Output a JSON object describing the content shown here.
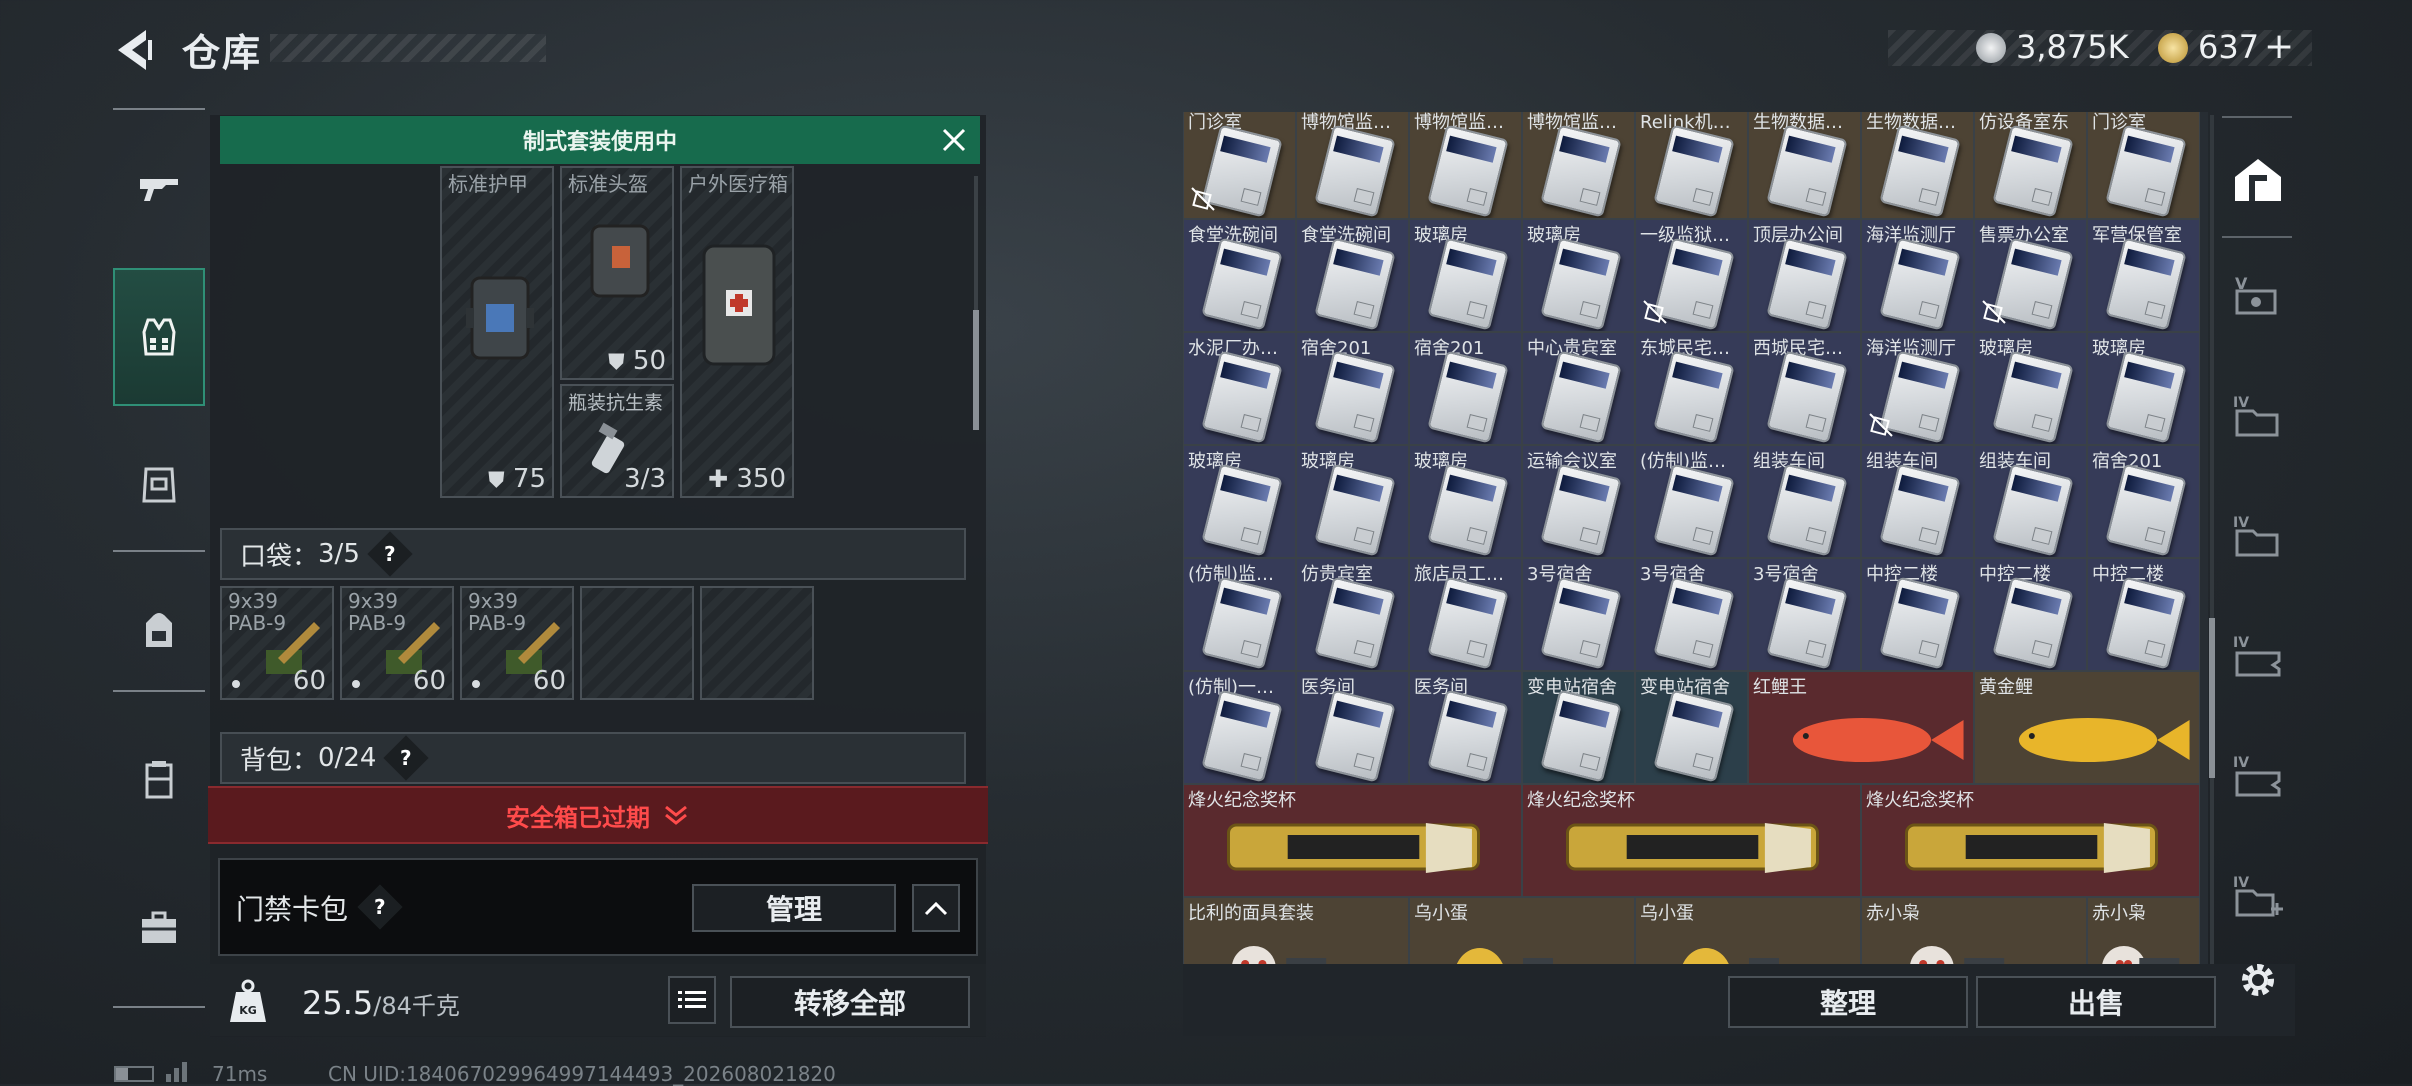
{
  "header": {
    "title": "仓库"
  },
  "currency": {
    "silver": "3,875K",
    "gold": "637",
    "gold_add": "+"
  },
  "nav": {
    "icons": [
      "gun-icon",
      "armor-vest-icon",
      "chest-rig-icon",
      "backpack-icon",
      "container-icon",
      "case-icon"
    ]
  },
  "banner": {
    "text": "制式套装使用中"
  },
  "equip": {
    "slots": [
      {
        "label": "标准护甲",
        "count": "75",
        "count_icon": "shield"
      },
      {
        "label": "标准头盔",
        "count": "50",
        "count_icon": "shield"
      },
      {
        "label": "户外医疗箱",
        "count": "350",
        "count_icon": "plus"
      }
    ],
    "sub_slot": {
      "label": "瓶装抗生素",
      "count": "3/3"
    }
  },
  "pocket": {
    "label": "口袋：",
    "value": "3/5",
    "items": [
      {
        "name": "9x39\nPAB-9",
        "count": "60"
      },
      {
        "name": "9x39\nPAB-9",
        "count": "60"
      },
      {
        "name": "9x39\nPAB-9",
        "count": "60"
      }
    ]
  },
  "backpack": {
    "label": "背包：",
    "value": "0/24"
  },
  "safebox": {
    "text": "安全箱已过期"
  },
  "keycard": {
    "label": "门禁卡包",
    "manage": "管理"
  },
  "weight": {
    "value": "25.5",
    "max": "/84千克",
    "icon_text": "KG"
  },
  "transfer_all": "转移全部",
  "grid": {
    "rows": [
      {
        "cells": [
          {
            "label": "门诊室",
            "bg": "#4d4334",
            "type": "card",
            "no": true
          },
          {
            "label": "博物馆监…",
            "bg": "#4d4334",
            "type": "card"
          },
          {
            "label": "博物馆监…",
            "bg": "#4d4334",
            "type": "card"
          },
          {
            "label": "博物馆监…",
            "bg": "#4d4334",
            "type": "card"
          },
          {
            "label": "Relink机…",
            "bg": "#4d4334",
            "type": "card"
          },
          {
            "label": "生物数据…",
            "bg": "#4d4334",
            "type": "card"
          },
          {
            "label": "生物数据…",
            "bg": "#4d4334",
            "type": "card"
          },
          {
            "label": "仿设备室东",
            "bg": "#4d4334",
            "type": "card"
          },
          {
            "label": "门诊室",
            "bg": "#4d4334",
            "type": "card"
          }
        ]
      },
      {
        "cells": [
          {
            "label": "食堂洗碗间",
            "bg": "#363b58",
            "type": "card"
          },
          {
            "label": "食堂洗碗间",
            "bg": "#363b58",
            "type": "card"
          },
          {
            "label": "玻璃房",
            "bg": "#363b58",
            "type": "card"
          },
          {
            "label": "玻璃房",
            "bg": "#363b58",
            "type": "card"
          },
          {
            "label": "一级监狱…",
            "bg": "#363b58",
            "type": "card",
            "no": true
          },
          {
            "label": "顶层办公间",
            "bg": "#363b58",
            "type": "card"
          },
          {
            "label": "海洋监测厅",
            "bg": "#363b58",
            "type": "card"
          },
          {
            "label": "售票办公室",
            "bg": "#363b58",
            "type": "card",
            "no": true
          },
          {
            "label": "军营保管室",
            "bg": "#363b58",
            "type": "card"
          }
        ]
      },
      {
        "cells": [
          {
            "label": "水泥厂办…",
            "bg": "#363b58",
            "type": "card"
          },
          {
            "label": "宿舍201",
            "bg": "#363b58",
            "type": "card"
          },
          {
            "label": "宿舍201",
            "bg": "#363b58",
            "type": "card"
          },
          {
            "label": "中心贵宾室",
            "bg": "#363b58",
            "type": "card"
          },
          {
            "label": "东城民宅…",
            "bg": "#363b58",
            "type": "card"
          },
          {
            "label": "西城民宅…",
            "bg": "#363b58",
            "type": "card"
          },
          {
            "label": "海洋监测厅",
            "bg": "#363b58",
            "type": "card",
            "no": true
          },
          {
            "label": "玻璃房",
            "bg": "#363b58",
            "type": "card"
          },
          {
            "label": "玻璃房",
            "bg": "#363b58",
            "type": "card"
          }
        ]
      },
      {
        "cells": [
          {
            "label": "玻璃房",
            "bg": "#363b58",
            "type": "card"
          },
          {
            "label": "玻璃房",
            "bg": "#363b58",
            "type": "card"
          },
          {
            "label": "玻璃房",
            "bg": "#363b58",
            "type": "card"
          },
          {
            "label": "运输会议室",
            "bg": "#363b58",
            "type": "card"
          },
          {
            "label": "(仿制)监…",
            "bg": "#363b58",
            "type": "card"
          },
          {
            "label": "组装车间",
            "bg": "#363b58",
            "type": "card"
          },
          {
            "label": "组装车间",
            "bg": "#363b58",
            "type": "card"
          },
          {
            "label": "组装车间",
            "bg": "#363b58",
            "type": "card"
          },
          {
            "label": "宿舍201",
            "bg": "#363b58",
            "type": "card"
          }
        ]
      },
      {
        "cells": [
          {
            "label": "(仿制)监…",
            "bg": "#363b58",
            "type": "card"
          },
          {
            "label": "仿贵宾室",
            "bg": "#363b58",
            "type": "card"
          },
          {
            "label": "旅店员工…",
            "bg": "#363b58",
            "type": "card"
          },
          {
            "label": "3号宿舍",
            "bg": "#363b58",
            "type": "card"
          },
          {
            "label": "3号宿舍",
            "bg": "#363b58",
            "type": "card"
          },
          {
            "label": "3号宿舍",
            "bg": "#363b58",
            "type": "card"
          },
          {
            "label": "中控二楼",
            "bg": "#363b58",
            "type": "card"
          },
          {
            "label": "中控二楼",
            "bg": "#363b58",
            "type": "card"
          },
          {
            "label": "中控二楼",
            "bg": "#363b58",
            "type": "card"
          }
        ]
      },
      {
        "cells": [
          {
            "label": "(仿制)一…",
            "bg": "#363b58",
            "type": "card"
          },
          {
            "label": "医务间",
            "bg": "#363b58",
            "type": "card"
          },
          {
            "label": "医务间",
            "bg": "#363b58",
            "type": "card"
          },
          {
            "label": "变电站宿舍",
            "bg": "#2c3f4a",
            "type": "card"
          },
          {
            "label": "变电站宿舍",
            "bg": "#2c3f4a",
            "type": "card"
          },
          {
            "label": "红鲤王",
            "bg": "#5a2a2e",
            "type": "fish-red",
            "span": 2
          },
          {
            "label": "黄金鲤",
            "bg": "#4d4334",
            "type": "fish-gold",
            "span": 2
          }
        ]
      },
      {
        "cells": [
          {
            "label": "烽火纪念奖杯",
            "bg": "#5a2a2e",
            "type": "trophy",
            "span": 3
          },
          {
            "label": "烽火纪念奖杯",
            "bg": "#5a2a2e",
            "type": "trophy",
            "span": 3
          },
          {
            "label": "烽火纪念奖杯",
            "bg": "#5a2a2e",
            "type": "trophy",
            "span": 3
          }
        ]
      },
      {
        "cells": [
          {
            "label": "比利的面具套装",
            "bg": "#4d4334",
            "type": "figure",
            "span": 2
          },
          {
            "label": "乌小蛋",
            "bg": "#4d4334",
            "type": "egg",
            "span": 2
          },
          {
            "label": "乌小蛋",
            "bg": "#4d4334",
            "type": "egg",
            "span": 2
          },
          {
            "label": "赤小枭",
            "bg": "#4d4334",
            "type": "figure",
            "span": 2
          },
          {
            "label": "赤小枭",
            "bg": "#4d4334",
            "type": "figure",
            "span": 1
          }
        ]
      }
    ]
  },
  "actions": {
    "sort": "整理",
    "sell": "出售"
  },
  "right_tabs": [
    "home-icon",
    "v-card-icon",
    "iv-folder-icon",
    "iv-folder-icon",
    "iv-ticket-icon",
    "iv-ticket-icon",
    "iv-folder-add-icon"
  ],
  "status": {
    "ping": "71ms",
    "uid": "CN UID:1840670299649971444​93_202608021820"
  },
  "colors": {
    "accent_green": "#176b4d",
    "danger_red": "#ff4b4b",
    "active_nav": "#2f8f76"
  }
}
